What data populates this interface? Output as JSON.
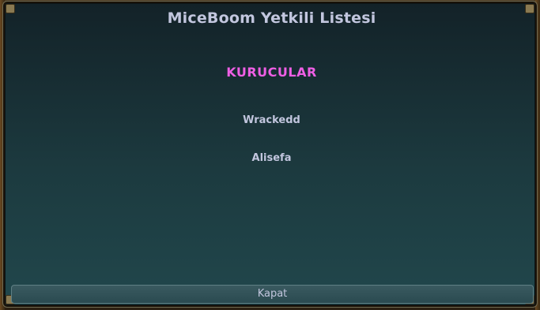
{
  "dialog": {
    "title": "MiceBoom Yetkili Listesi",
    "section": {
      "heading": "KURUCULAR",
      "heading_color": "#ef5fe5",
      "members": [
        "Wrackedd",
        "Alisefa"
      ]
    },
    "close_label": "Kapat"
  },
  "colors": {
    "text": "#c2c6de",
    "panel_top": "#132228",
    "panel_bottom": "#21474c",
    "button": "#2f4f55"
  }
}
